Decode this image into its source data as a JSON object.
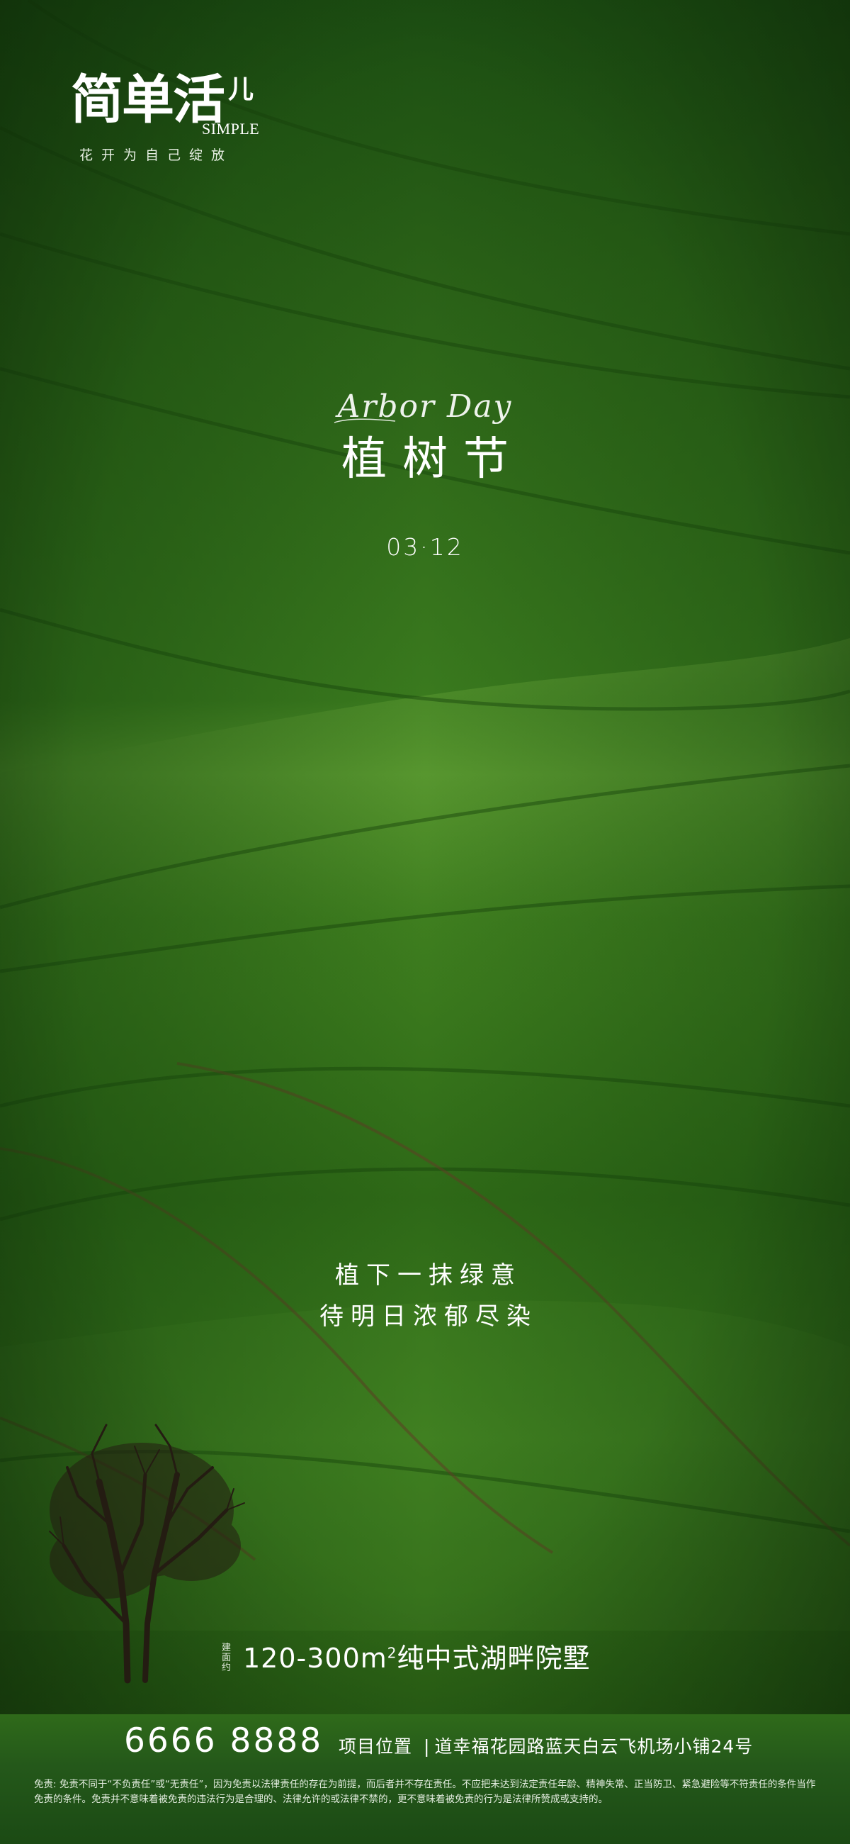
{
  "brand": {
    "title": "简单活",
    "title_small": "儿",
    "english": "SIMPLE",
    "slogan": "花开为自己绽放"
  },
  "festival": {
    "english": "Arbor Day",
    "title": "植树节",
    "date": "03·12"
  },
  "poem": {
    "line1": "植下一抹绿意",
    "line2": "待明日浓郁尽染"
  },
  "offer": {
    "tag": "建面约",
    "text_before_sup": "120-300m",
    "sup": "2",
    "text_after_sup": "纯中式湖畔院墅"
  },
  "footer": {
    "hotline": "6666 8888",
    "address_label": "项目位置",
    "address_separator": "|",
    "address": "道幸福花园路蓝天白云飞机场小铺24号",
    "disclaimer": "免责: 免责不同于“不负责任”或“无责任”，因为免责以法律责任的存在为前提，而后者并不存在责任。不应把未达到法定责任年龄、精神失常、正当防卫、紧急避险等不符责任的条件当作免责的条件。免责并不意味着被免责的违法行为是合理的、法律允许的或法律不禁的，更不意味着被免责的行为是法律所赞成或支持的。"
  },
  "colors": {
    "field_light": "#6aa83a",
    "field_mid": "#3f7f1f",
    "field_dark": "#14400c",
    "furrow": "#17420b",
    "tree": "#241c12",
    "text": "#ffffff"
  }
}
